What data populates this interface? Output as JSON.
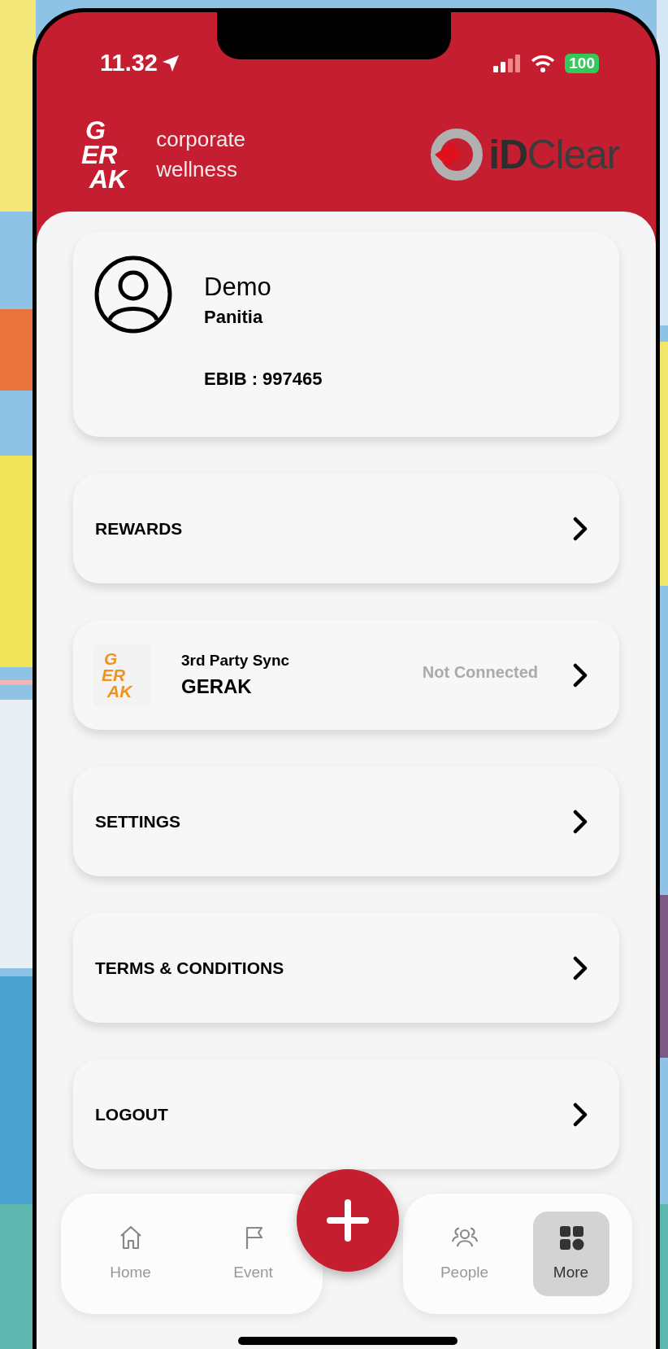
{
  "status_bar": {
    "time": "11.32",
    "battery": "100"
  },
  "header": {
    "brand_logo": [
      "G",
      "ER",
      "AK"
    ],
    "tagline": [
      "corporate",
      "wellness"
    ],
    "partner_logo": [
      "iD",
      "Clear"
    ]
  },
  "profile": {
    "name": "Demo",
    "role": "Panitia",
    "ebib": "EBIB : 997465"
  },
  "menu": [
    {
      "kind": "link",
      "label": "REWARDS"
    },
    {
      "kind": "sync",
      "caption": "3rd Party Sync",
      "label": "GERAK",
      "logo": [
        "G",
        "ER",
        "AK"
      ],
      "status": "Not Connected"
    },
    {
      "kind": "link",
      "label": "SETTINGS"
    },
    {
      "kind": "link",
      "label": "TERMS & CONDITIONS"
    },
    {
      "kind": "link",
      "label": "LOGOUT"
    }
  ],
  "nav": [
    {
      "kind": "home",
      "label": "Home",
      "selected": false
    },
    {
      "kind": "event",
      "label": "Event",
      "selected": false
    },
    {
      "kind": "people",
      "label": "People",
      "selected": false
    },
    {
      "kind": "more",
      "label": "More",
      "selected": true
    }
  ]
}
